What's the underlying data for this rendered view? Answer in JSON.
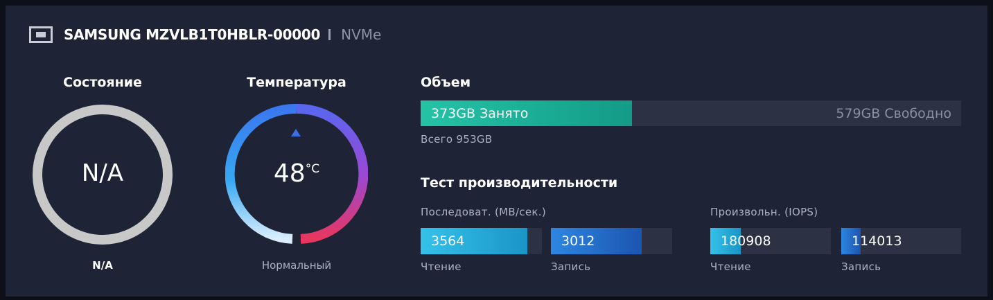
{
  "header": {
    "model": "SAMSUNG MZVLB1T0HBLR-00000",
    "interface": "NVMe",
    "icon": "drive-icon"
  },
  "health": {
    "title": "Состояние",
    "value": "N/A",
    "status": "N/A"
  },
  "temperature": {
    "title": "Температура",
    "value": "48",
    "unit": "°C",
    "status": "Нормальный"
  },
  "capacity": {
    "title": "Объем",
    "used_label": "373GB Занято",
    "free_label": "579GB Свободно",
    "total_label": "Всего 953GB",
    "used_gb": 373,
    "free_gb": 579,
    "total_gb": 953
  },
  "performance": {
    "title": "Тест производительности",
    "sequential": {
      "label": "Последоват. (MB/сек.)",
      "read": {
        "value": "3564",
        "caption": "Чтение",
        "fill": 0.88
      },
      "write": {
        "value": "3012",
        "caption": "Запись",
        "fill": 0.75
      }
    },
    "random": {
      "label": "Произвольн. (IOPS)",
      "read": {
        "value": "180908",
        "caption": "Чтение",
        "fill": 0.25
      },
      "write": {
        "value": "114013",
        "caption": "Запись",
        "fill": 0.16
      }
    }
  },
  "colors": {
    "card_bg": "#1e2335",
    "page_bg": "#0d1019",
    "track": "#2c3244",
    "used_fill": "#1fb89a",
    "seq_fill": "#2aa9dc",
    "rand_fill": "#1f7bd6",
    "ring_gray": "#c8c8c8",
    "temp_red": "#e8365f"
  }
}
